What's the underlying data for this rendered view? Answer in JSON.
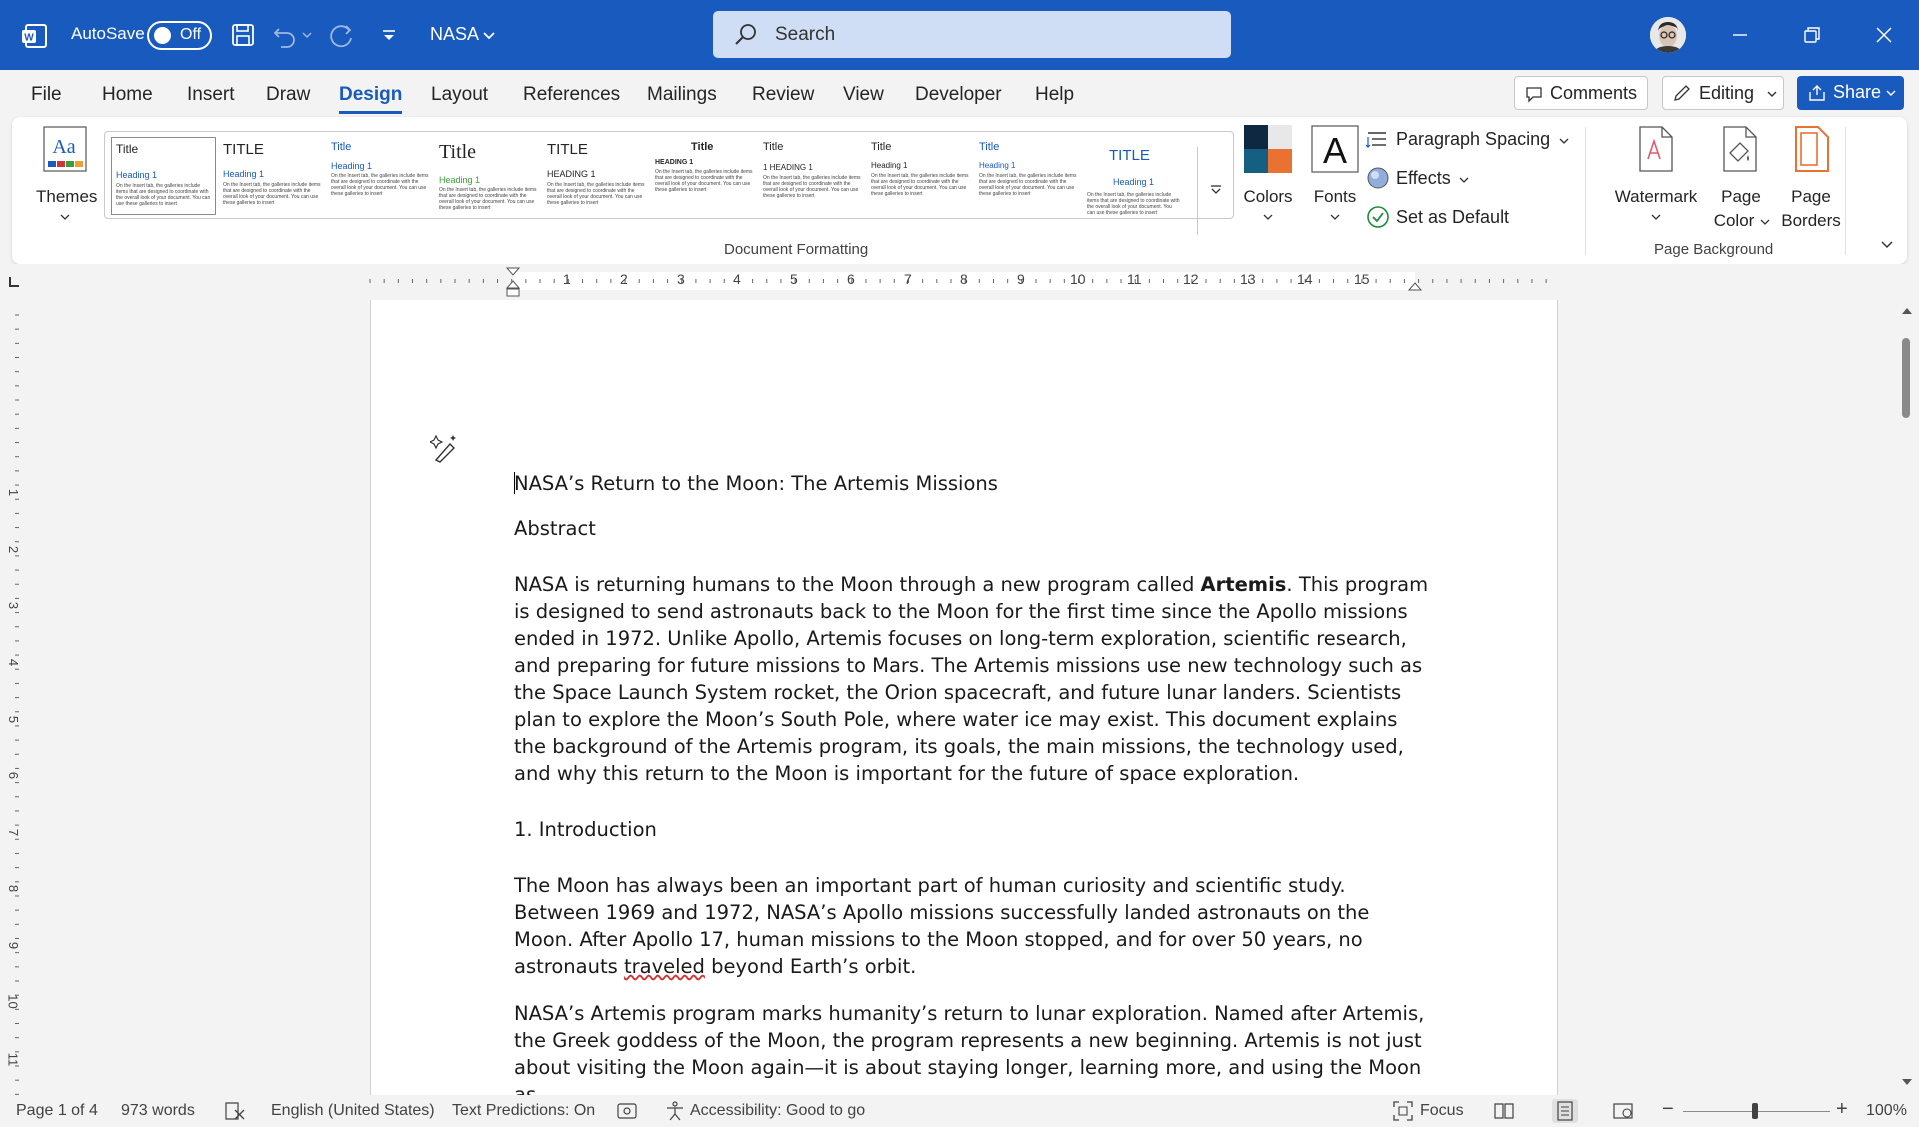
{
  "titlebar": {
    "autosave_label": "AutoSave",
    "autosave_state": "Off",
    "doc_name": "NASA",
    "search_placeholder": "Search"
  },
  "menu": {
    "items": [
      "File",
      "Home",
      "Insert",
      "Draw",
      "Design",
      "Layout",
      "References",
      "Mailings",
      "Review",
      "View",
      "Developer",
      "Help"
    ],
    "active": "Design",
    "comments": "Comments",
    "editing": "Editing",
    "share": "Share"
  },
  "ribbon": {
    "themes": "Themes",
    "style_title_samples": [
      "Title",
      "TITLE",
      "Title",
      "Title",
      "TITLE",
      "Title",
      "Title",
      "Title",
      "Title",
      "TITLE"
    ],
    "style_heading_samples": [
      "Heading 1",
      "Heading 1",
      "Heading 1",
      "Heading 1",
      "HEADING 1",
      "HEADING 1",
      "1 HEADING 1",
      "Heading 1",
      "Heading 1",
      "Heading 1"
    ],
    "style_body_sample": "On the Insert tab, the galleries include items that are designed to coordinate with the overall look of your document. You can use these galleries to insert",
    "colors": "Colors",
    "fonts": "Fonts",
    "paragraph_spacing": "Paragraph Spacing",
    "effects": "Effects",
    "set_as_default": "Set as Default",
    "document_formatting": "Document Formatting",
    "watermark": "Watermark",
    "page_color_1": "Page",
    "page_color_2": "Color",
    "page_borders_1": "Page",
    "page_borders_2": "Borders",
    "page_background": "Page Background"
  },
  "ruler": {
    "marks": [
      "1",
      "2",
      "3",
      "4",
      "5",
      "6",
      "7",
      "8",
      "9",
      "10",
      "11",
      "12",
      "13",
      "14",
      "15"
    ],
    "v_marks": [
      "1",
      "2",
      "3",
      "4",
      "5",
      "6",
      "7",
      "8",
      "9",
      "10",
      "11"
    ]
  },
  "document": {
    "title": "NASA’s Return to the Moon: The Artemis Missions",
    "abstract_heading": "Abstract",
    "abstract_pre": "NASA is returning humans to the Moon through a new program called ",
    "abstract_bold": "Artemis",
    "abstract_post": ". This program is designed to send astronauts back to the Moon for the first time since the Apollo missions ended in 1972. Unlike Apollo, Artemis focuses on long-term exploration, scientific research, and preparing for future missions to Mars. The Artemis missions use new technology such as the Space Launch System rocket, the Orion spacecraft, and future lunar landers. Scientists plan to explore the Moon’s South Pole, where water ice may exist. This document explains the background of the Artemis program, its goals, the main missions, the technology used, and why this return to the Moon is important for the future of space exploration.",
    "intro_heading": "1. Introduction",
    "p1_pre": "The Moon has always been an important part of human curiosity and scientific study. Between 1969 and 1972, NASA’s Apollo missions successfully landed astronauts on the Moon. After Apollo 17, human missions to the Moon stopped, and for over 50 years, no astronauts ",
    "p1_misspelled": "traveled",
    "p1_post": " beyond Earth’s orbit.",
    "p2": "NASA’s Artemis program marks humanity’s return to lunar exploration. Named after Artemis, the Greek goddess of the Moon, the program represents a new beginning. Artemis is not just about visiting the Moon again—it is about staying longer, learning more, and using the Moon as"
  },
  "status": {
    "page": "Page 1 of 4",
    "words": "973 words",
    "language": "English (United States)",
    "predictions": "Text Predictions: On",
    "accessibility": "Accessibility: Good to go",
    "focus": "Focus",
    "zoom_minus": "−",
    "zoom_plus": "+",
    "zoom": "100%"
  },
  "colors": {
    "brand": "#185abd",
    "squiggle": "#d13438"
  }
}
